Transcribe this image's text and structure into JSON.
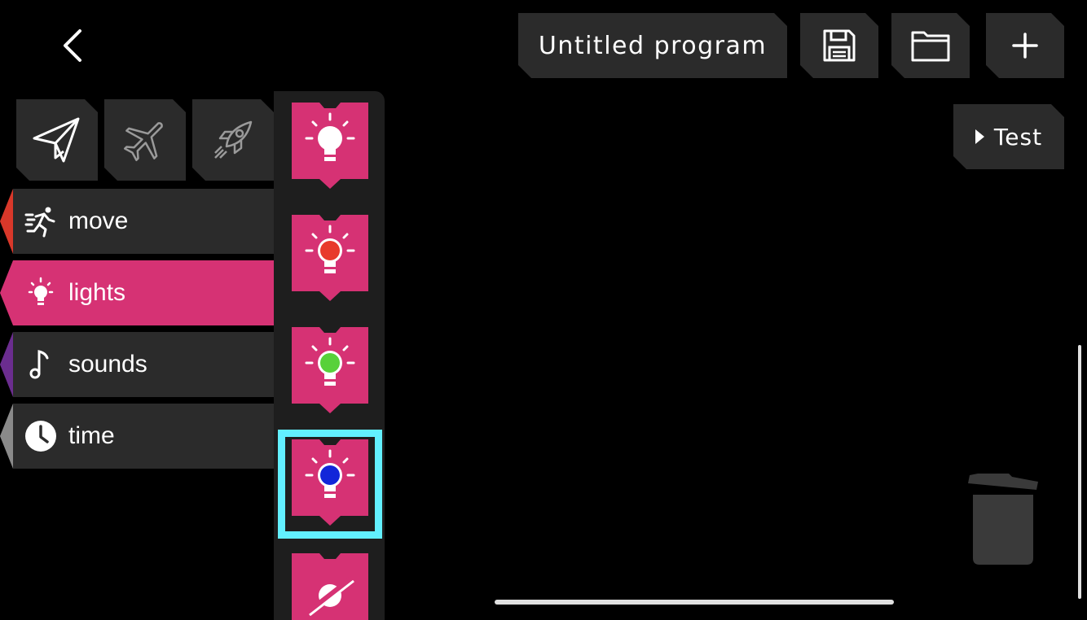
{
  "header": {
    "back_icon": "chevron-left-icon",
    "program_title": "Untitled program",
    "save_icon": "floppy-disk-icon",
    "open_icon": "folder-icon",
    "add_icon": "plus-icon"
  },
  "test_button": {
    "label": "Test",
    "icon": "play-triangle-icon"
  },
  "vehicles": [
    {
      "icon": "paper-plane-icon",
      "selected": true
    },
    {
      "icon": "airplane-icon",
      "selected": false
    },
    {
      "icon": "rocket-icon",
      "selected": false
    }
  ],
  "categories": [
    {
      "label": "move",
      "icon": "running-person-icon",
      "color": "#d9382a",
      "active": false
    },
    {
      "label": "lights",
      "icon": "lightbulb-icon",
      "color": "#d63274",
      "active": true
    },
    {
      "label": "sounds",
      "icon": "music-note-icon",
      "color": "#6b2d8f",
      "active": false
    },
    {
      "label": "time",
      "icon": "clock-icon",
      "color": "#8a8a8a",
      "active": false
    }
  ],
  "blocks": [
    {
      "name": "light-white-block",
      "bulb_color": "#ffffff",
      "selected": false
    },
    {
      "name": "light-red-block",
      "bulb_color": "#e83a2c",
      "selected": false
    },
    {
      "name": "light-green-block",
      "bulb_color": "#58d13a",
      "selected": false
    },
    {
      "name": "light-blue-block",
      "bulb_color": "#1226d9",
      "selected": true
    },
    {
      "name": "light-off-block",
      "bulb_color": "#d63274",
      "selected": false
    }
  ],
  "colors": {
    "accent_pink": "#d63274",
    "selection": "#62f0ff",
    "panel": "#2b2b2b",
    "background": "#000000"
  },
  "trash_icon": "trash-can-icon"
}
